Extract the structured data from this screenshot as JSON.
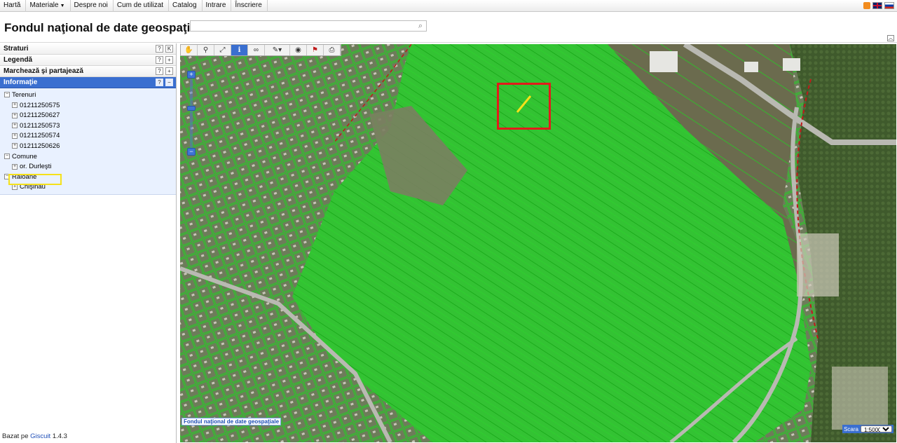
{
  "menu": {
    "items": [
      "Hartă",
      "Materiale",
      "Despre noi",
      "Cum de utilizat",
      "Catalog",
      "Intrare",
      "Înscriere"
    ],
    "right_icons": [
      "rss-icon",
      "uk-flag-icon",
      "ru-flag-icon"
    ]
  },
  "header": {
    "title": "Fondul naţional de date geospaţiale",
    "search_placeholder": ""
  },
  "sidebar": {
    "sections": [
      {
        "label": "Straturi"
      },
      {
        "label": "Legendă"
      },
      {
        "label": "Marchează şi partajează"
      },
      {
        "label": "Informaţie"
      }
    ],
    "tree": [
      {
        "label": "Terenuri",
        "level": 0
      },
      {
        "label": "01211250575",
        "level": 1
      },
      {
        "label": "01211250627",
        "level": 1
      },
      {
        "label": "01211250573",
        "level": 1
      },
      {
        "label": "01211250574",
        "level": 1
      },
      {
        "label": "01211250626",
        "level": 1
      },
      {
        "label": "Comune",
        "level": 0
      },
      {
        "label": "or. Durleşti",
        "level": 1
      },
      {
        "label": "Raioane",
        "level": 0
      },
      {
        "label": "Chişinău",
        "level": 1
      }
    ],
    "footer_prefix": "Bazat pe",
    "footer_link": "Giscuit",
    "footer_version": "1.4.3"
  },
  "map": {
    "attribution": "Fondul naţional de date geospaţiale",
    "scale_label": "Scara",
    "scale_value": "1:5000"
  },
  "colors": {
    "accent": "#3a6fd0",
    "parcel_green": "#2ee02e",
    "highlight_yellow": "#f5e11a",
    "selection_red": "#e31b1b"
  }
}
